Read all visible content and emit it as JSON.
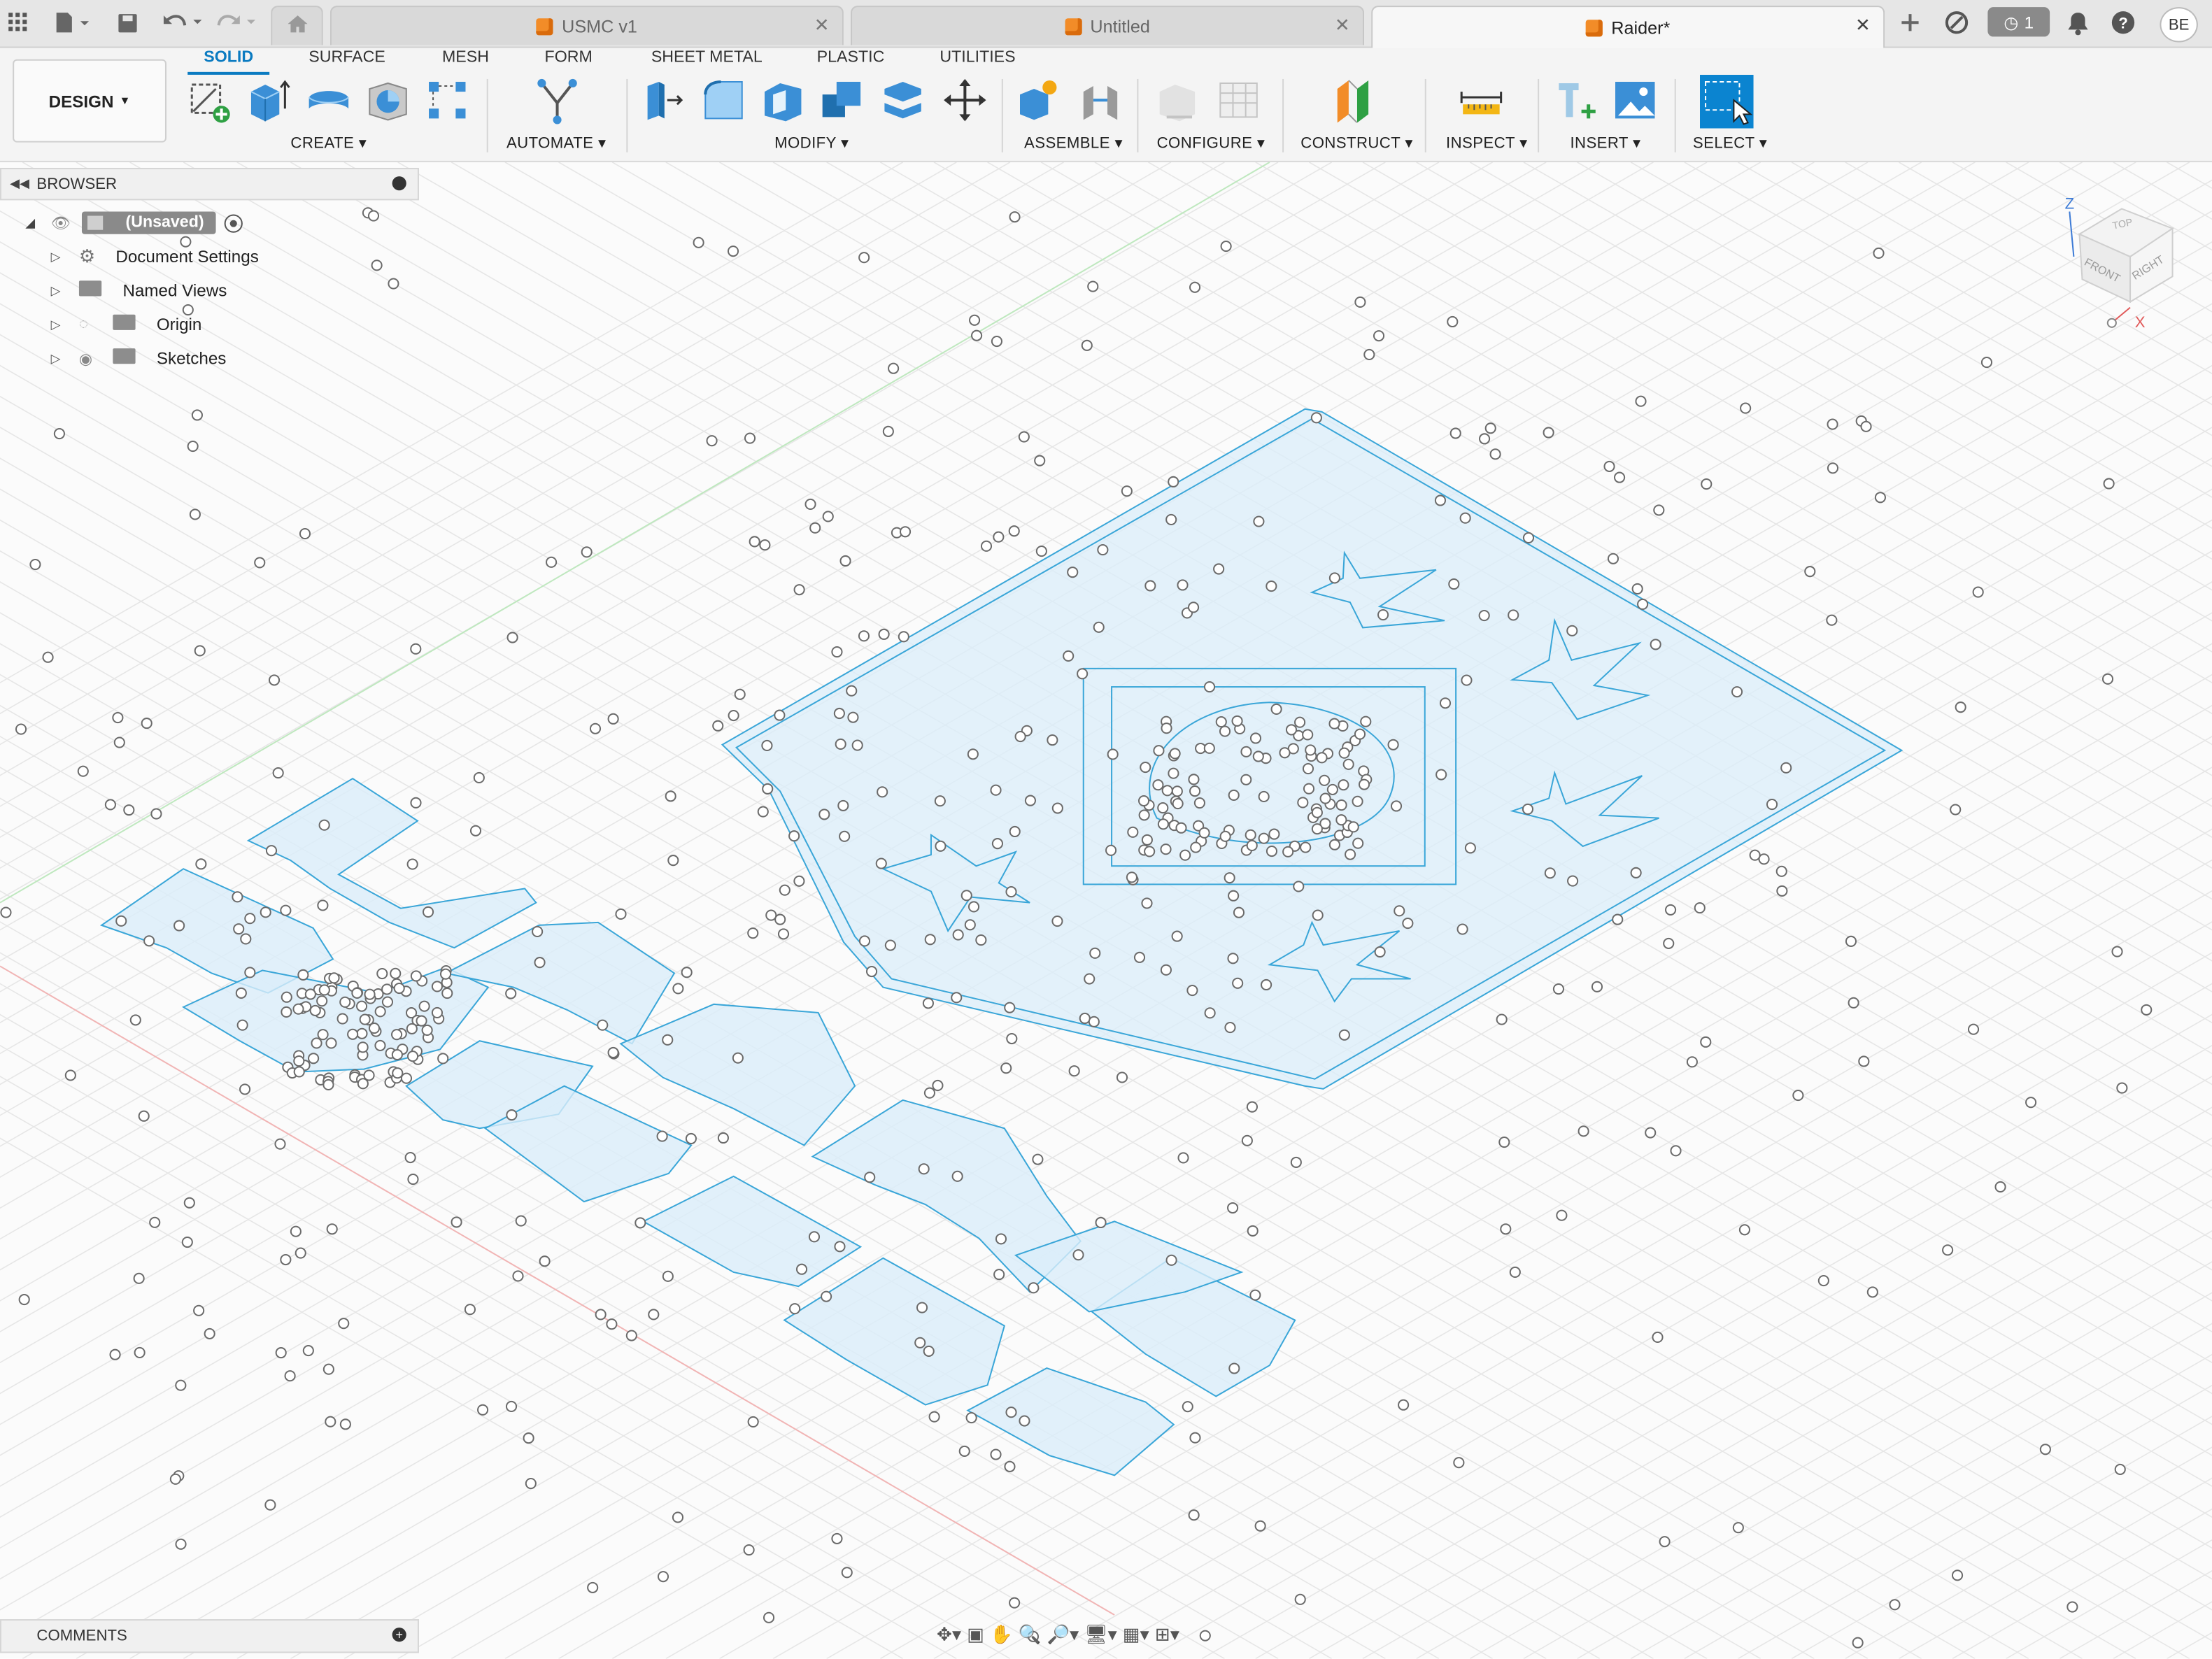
{
  "tabs": [
    {
      "label": "USMC v1",
      "active": false
    },
    {
      "label": "Untitled",
      "active": false
    },
    {
      "label": "Raider*",
      "active": true
    }
  ],
  "top_icons": [
    "grid-menu-icon",
    "file-icon",
    "save-icon",
    "undo-icon",
    "redo-icon",
    "home-icon"
  ],
  "job_status_count": "1",
  "user_initials": "BE",
  "workspace": "DESIGN",
  "ribbon_tabs": [
    "SOLID",
    "SURFACE",
    "MESH",
    "FORM",
    "SHEET METAL",
    "PLASTIC",
    "UTILITIES"
  ],
  "groups": {
    "create": "CREATE",
    "automate": "AUTOMATE",
    "modify": "MODIFY",
    "assemble": "ASSEMBLE",
    "configure": "CONFIGURE",
    "construct": "CONSTRUCT",
    "inspect": "INSPECT",
    "insert": "INSERT",
    "select": "SELECT"
  },
  "browser": {
    "title": "BROWSER",
    "root": "(Unsaved)",
    "items": [
      "Document Settings",
      "Named Views",
      "Origin",
      "Sketches"
    ]
  },
  "comments": "COMMENTS",
  "viewcube": {
    "top": "TOP",
    "front": "FRONT",
    "right": "RIGHT",
    "axis_z": "Z",
    "axis_x": "X"
  },
  "colors": {
    "accent": "#0b7bc1",
    "sketch_fill": "#dbeefa",
    "sketch_line": "#3aa6d8",
    "grid": "#e3e3e3"
  }
}
